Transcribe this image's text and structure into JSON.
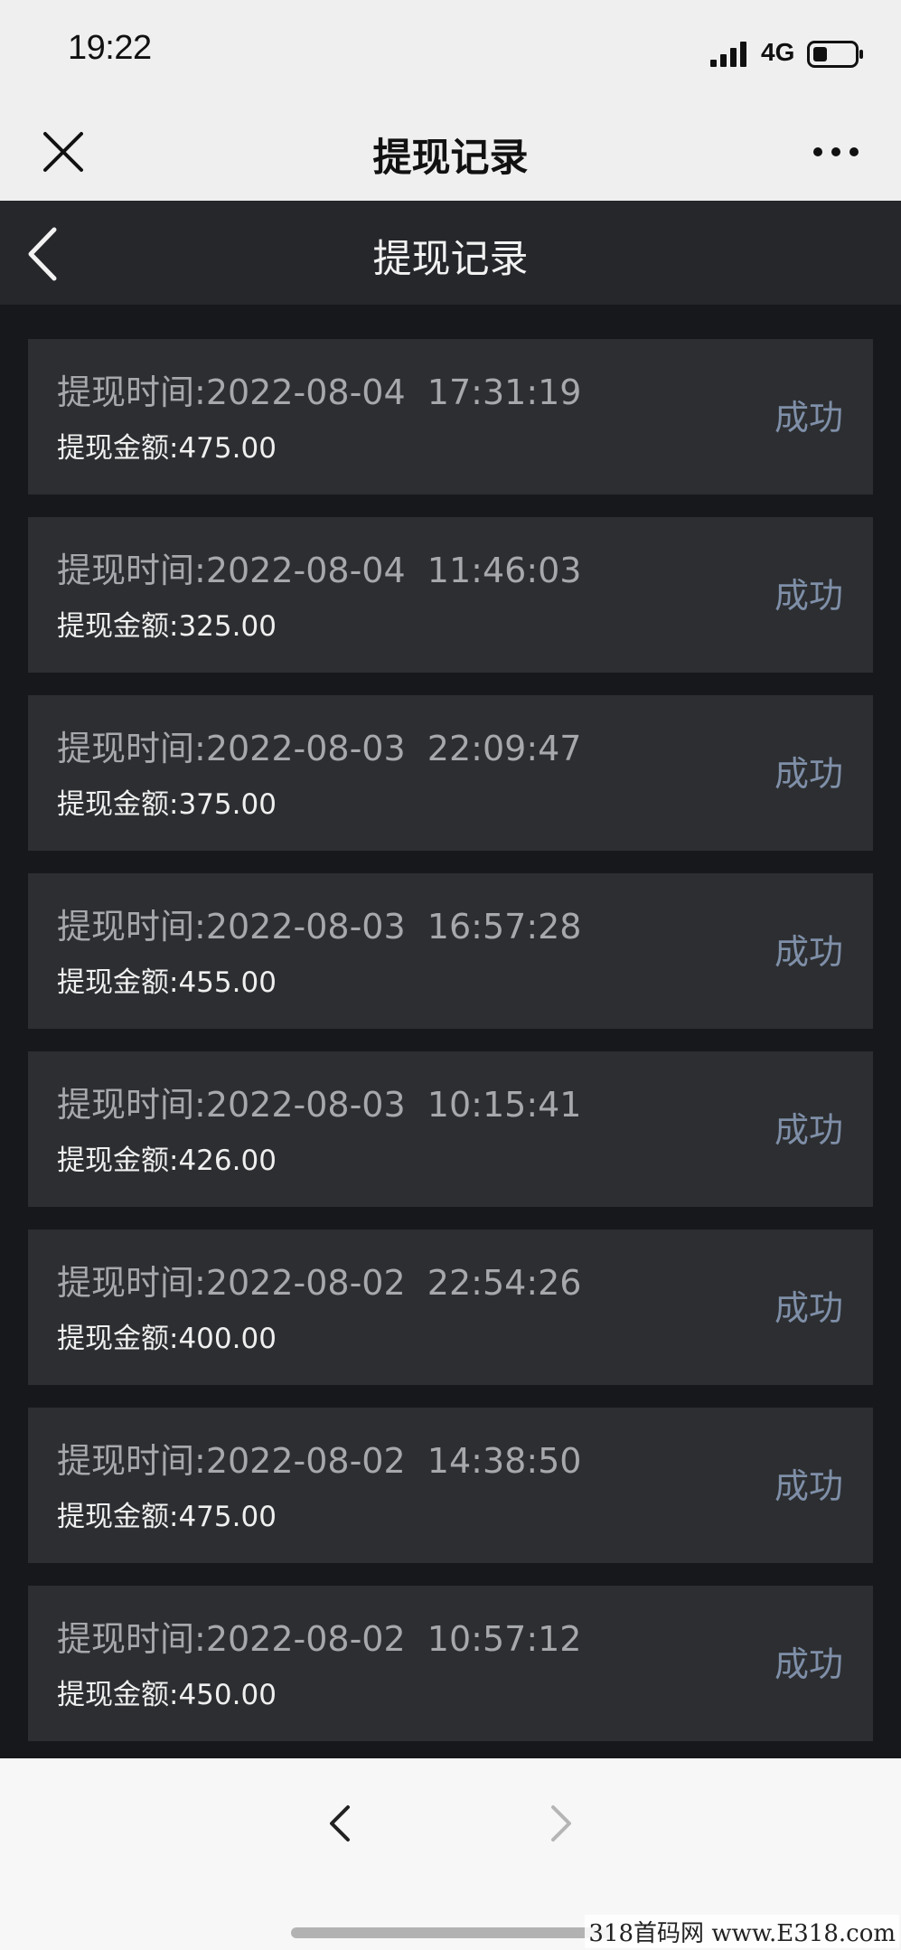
{
  "status_bar": {
    "time": "19:22",
    "network": "4G",
    "battery_icon": "battery-low-icon",
    "signal_icon": "cellular-signal-icon"
  },
  "wechat_header": {
    "title": "提现记录",
    "close_icon": "close-icon",
    "more_icon": "more-dots-icon"
  },
  "page_header": {
    "title": "提现记录",
    "back_icon": "chevron-left-icon"
  },
  "records": [
    {
      "time_label": "提现时间:",
      "time": "2022-08-04  17:31:19",
      "amount_label": "提现金额:",
      "amount": "475.00",
      "status": "成功"
    },
    {
      "time_label": "提现时间:",
      "time": "2022-08-04  11:46:03",
      "amount_label": "提现金额:",
      "amount": "325.00",
      "status": "成功"
    },
    {
      "time_label": "提现时间:",
      "time": "2022-08-03  22:09:47",
      "amount_label": "提现金额:",
      "amount": "375.00",
      "status": "成功"
    },
    {
      "time_label": "提现时间:",
      "time": "2022-08-03  16:57:28",
      "amount_label": "提现金额:",
      "amount": "455.00",
      "status": "成功"
    },
    {
      "time_label": "提现时间:",
      "time": "2022-08-03  10:15:41",
      "amount_label": "提现金额:",
      "amount": "426.00",
      "status": "成功"
    },
    {
      "time_label": "提现时间:",
      "time": "2022-08-02  22:54:26",
      "amount_label": "提现金额:",
      "amount": "400.00",
      "status": "成功"
    },
    {
      "time_label": "提现时间:",
      "time": "2022-08-02  14:38:50",
      "amount_label": "提现金额:",
      "amount": "475.00",
      "status": "成功"
    },
    {
      "time_label": "提现时间:",
      "time": "2022-08-02  10:57:12",
      "amount_label": "提现金额:",
      "amount": "450.00",
      "status": "成功"
    }
  ],
  "bottom_bar": {
    "back_icon": "chevron-left-icon",
    "forward_icon": "chevron-right-icon"
  },
  "watermark": "318首码网  www.E318.com",
  "colors": {
    "page_background": "#16181b",
    "card_background": "#2c2e31",
    "status_text": "#7f8fa8",
    "wechat_bar": "#efefef"
  }
}
